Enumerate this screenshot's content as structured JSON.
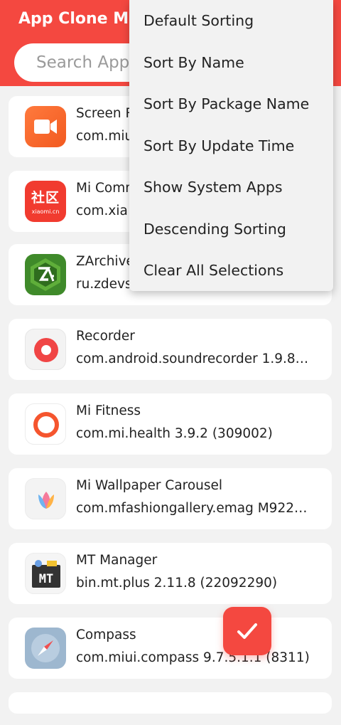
{
  "header": {
    "title": "App Clone Ma",
    "search_placeholder": "Search Apps"
  },
  "apps": [
    {
      "name": "Screen R",
      "package": "com.miui",
      "icon": "screen-recorder-icon"
    },
    {
      "name": "Mi Comm",
      "package": "com.xia",
      "icon": "mi-community-icon",
      "icon_text": "社区",
      "icon_subtext": "xiaomi.cn"
    },
    {
      "name": "ZArchive",
      "package": "ru.zdevs",
      "icon": "zarchiver-icon"
    },
    {
      "name": "Recorder",
      "package": "com.android.soundrecorder 1.9.8…",
      "icon": "recorder-icon"
    },
    {
      "name": "Mi Fitness",
      "package": "com.mi.health 3.9.2 (309002)",
      "icon": "mi-fitness-icon"
    },
    {
      "name": "Mi Wallpaper Carousel",
      "package": "com.mfashiongallery.emag M922…",
      "icon": "wallpaper-carousel-icon"
    },
    {
      "name": "MT Manager",
      "package": "bin.mt.plus 2.11.8 (22092290)",
      "icon": "mt-manager-icon",
      "icon_text": "MT"
    },
    {
      "name": "Compass",
      "package": "com.miui.compass 9.7.5.1.1 (8311)",
      "icon": "compass-icon"
    }
  ],
  "sort_menu": {
    "items": [
      "Default Sorting",
      "Sort By Name",
      "Sort By Package Name",
      "Sort By Update Time",
      "Show System Apps",
      "Descending Sorting",
      "Clear All Selections"
    ]
  },
  "fab": {
    "icon": "checkmark-icon"
  },
  "colors": {
    "accent": "#f44840",
    "background": "#f2f2f2",
    "card": "#ffffff"
  }
}
